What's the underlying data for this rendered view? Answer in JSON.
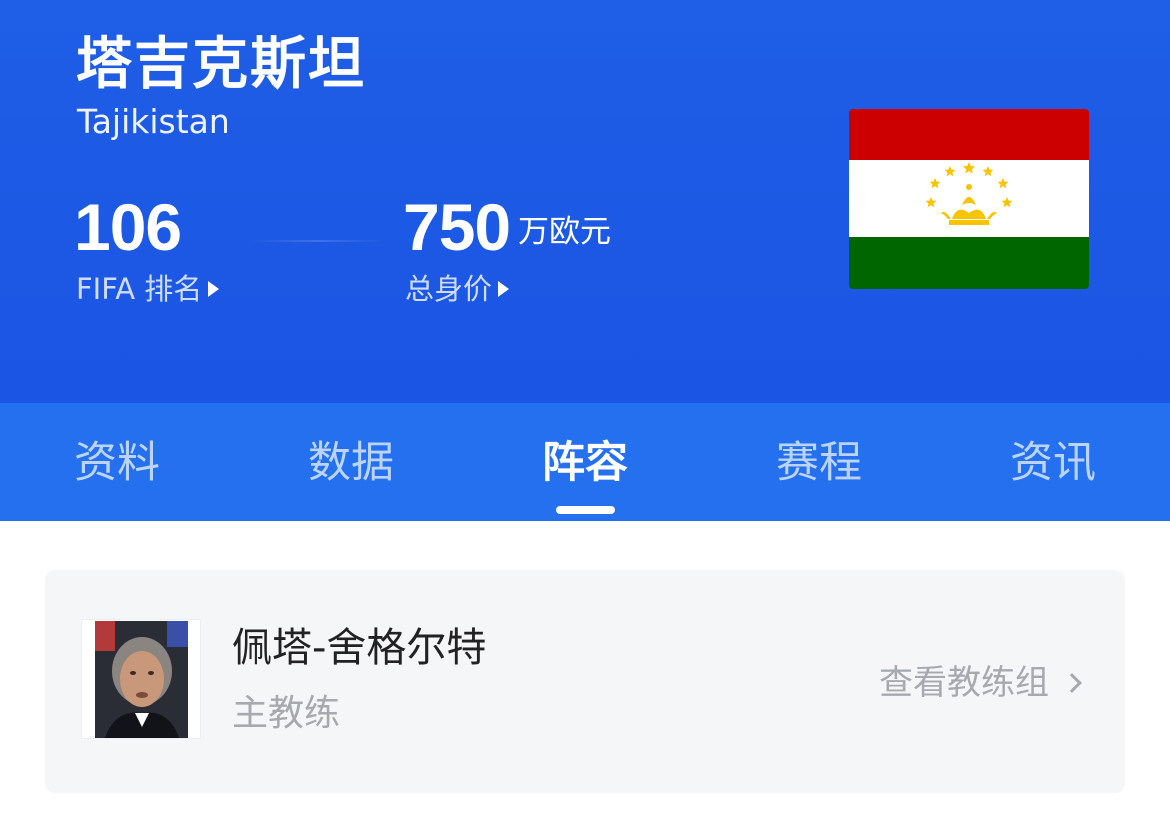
{
  "team": {
    "name_cn": "塔吉克斯坦",
    "name_en": "Tajikistan"
  },
  "stats": {
    "fifa_rank_value": "106",
    "fifa_rank_label": "FIFA 排名",
    "total_value": "750",
    "total_value_unit": "万欧元",
    "total_value_label": "总身价"
  },
  "flag": {
    "icon": "tajikistan-flag",
    "colors": {
      "red": "#cc0000",
      "white": "#ffffff",
      "green": "#006600",
      "gold": "#f8c300"
    }
  },
  "tabs": [
    {
      "label": "资料",
      "active": false
    },
    {
      "label": "数据",
      "active": false
    },
    {
      "label": "阵容",
      "active": true
    },
    {
      "label": "赛程",
      "active": false
    },
    {
      "label": "资讯",
      "active": false
    }
  ],
  "coach": {
    "name": "佩塔-舍格尔特",
    "role": "主教练",
    "staff_link": "查看教练组"
  },
  "colors": {
    "header_blue": "#1f5ee6",
    "tab_blue": "#2470ee",
    "card_bg": "#f5f6f8"
  }
}
